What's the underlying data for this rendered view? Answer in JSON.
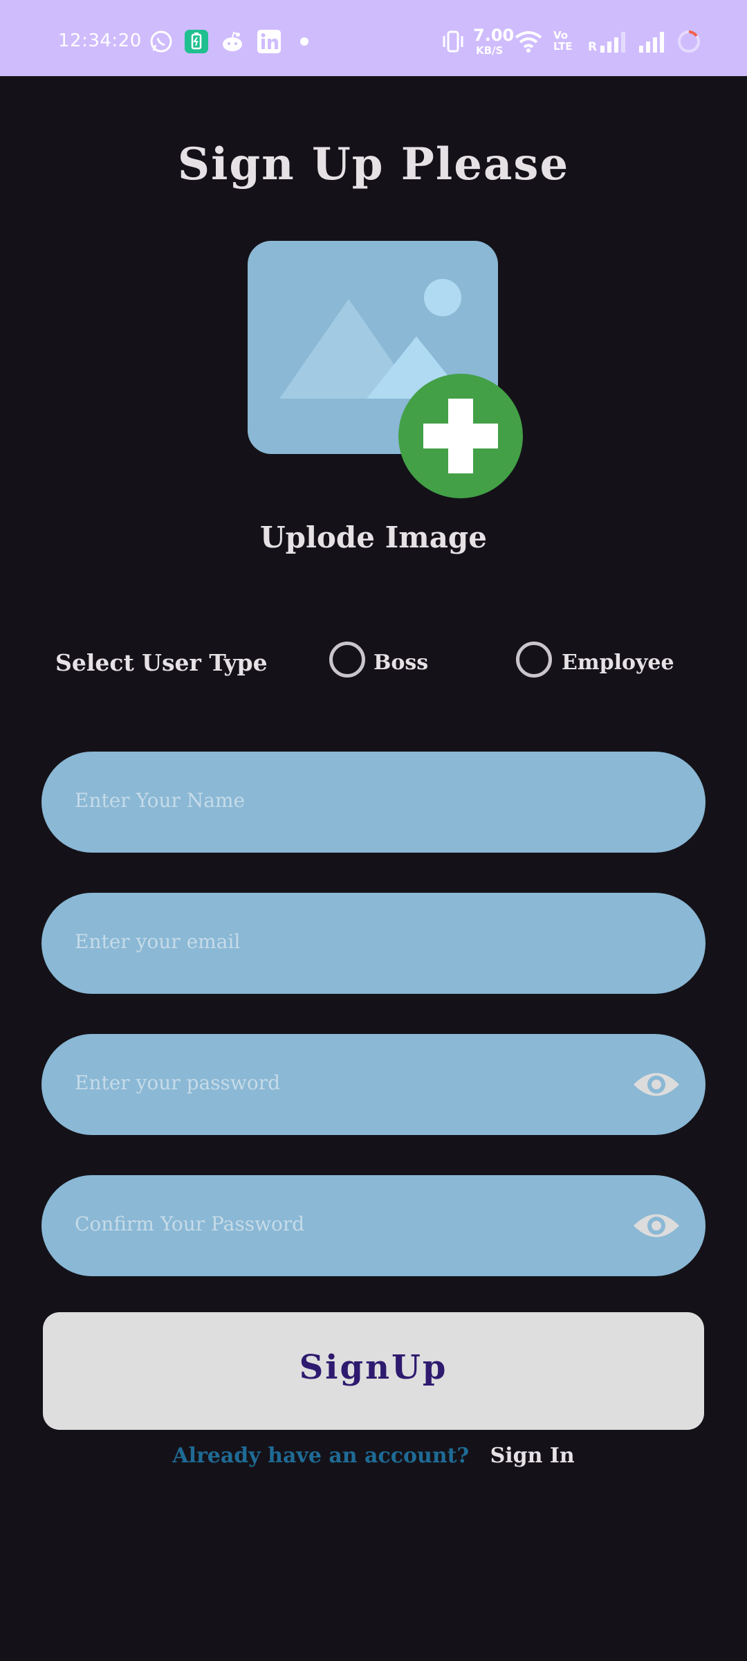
{
  "status_bar": {
    "time": "12:34:20",
    "net_speed_value": "7.00",
    "net_speed_unit": "KB/S",
    "volte_top": "Vo",
    "volte_bottom": "LTE",
    "carrier_r": "R"
  },
  "title": "Sign Up Please",
  "upload": {
    "caption": "Uplode Image"
  },
  "user_type": {
    "label": "Select User Type",
    "options": [
      "Boss",
      "Employee"
    ]
  },
  "form": {
    "name_placeholder": "Enter Your Name",
    "email_placeholder": "Enter your email",
    "password_placeholder": "Enter your password",
    "confirm_placeholder": "Confirm Your Password"
  },
  "signup_button": "SignUp",
  "footer": {
    "question": "Already have an account?",
    "link": "Sign In"
  },
  "colors": {
    "background": "#141218",
    "status_bar": "#cfbcfd",
    "field": "#8ab8d5",
    "plus_badge": "#43a047",
    "button": "#dedede",
    "button_text": "#2e1a6e",
    "link_question": "#1f6b96"
  }
}
